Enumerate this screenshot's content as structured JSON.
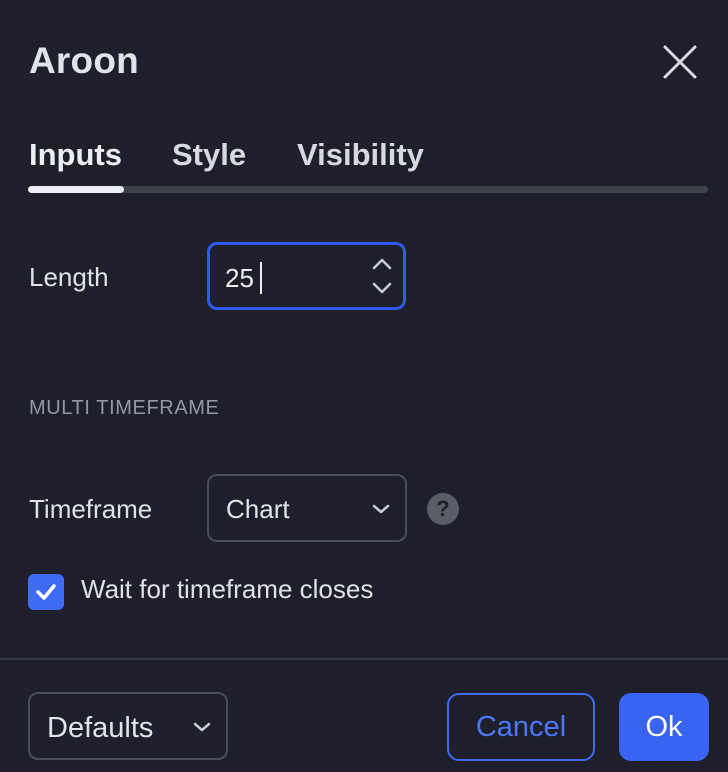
{
  "dialog": {
    "title": "Aroon",
    "close_icon": "close-icon"
  },
  "tabs": [
    {
      "label": "Inputs",
      "active": true
    },
    {
      "label": "Style",
      "active": false
    },
    {
      "label": "Visibility",
      "active": false
    }
  ],
  "inputs": {
    "length": {
      "label": "Length",
      "value": "25"
    },
    "section_title": "MULTI TIMEFRAME",
    "timeframe": {
      "label": "Timeframe",
      "selected": "Chart",
      "help_icon": "question-mark-icon",
      "help_glyph": "?"
    },
    "wait_closes": {
      "label": "Wait for timeframe closes",
      "checked": true
    }
  },
  "footer": {
    "defaults_label": "Defaults",
    "cancel_label": "Cancel",
    "ok_label": "Ok"
  },
  "colors": {
    "background": "#1e1f2b",
    "accent": "#3964f2",
    "focus_border": "#2d5bf0"
  }
}
